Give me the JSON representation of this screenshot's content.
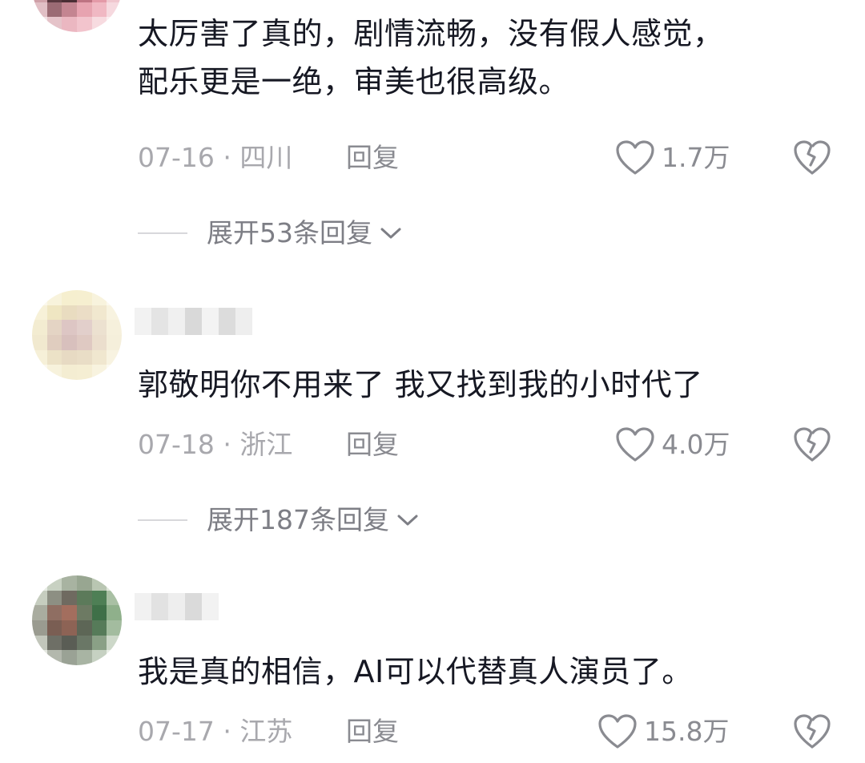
{
  "comments": [
    {
      "text_lines": [
        "太厉害了真的，剧情流畅，没有假人感觉，",
        "配乐更是一绝，审美也很高级。"
      ],
      "date_location": "07-16 · 四川",
      "reply_label": "回复",
      "likes": "1.7万",
      "expand_label": "展开53条回复"
    },
    {
      "text_lines": [
        "郭敬明你不用来了 我又找到我的小时代了"
      ],
      "date_location": "07-18 · 浙江",
      "reply_label": "回复",
      "likes": "4.0万",
      "expand_label": "展开187条回复"
    },
    {
      "text_lines": [
        "我是真的相信，AI可以代替真人演员了。"
      ],
      "date_location": "07-17 · 江苏",
      "reply_label": "回复",
      "likes": "15.8万"
    }
  ],
  "icons": {
    "like": "heart-outline-icon",
    "dislike": "broken-heart-icon",
    "expand": "chevron-down-icon"
  },
  "colors": {
    "text_primary": "#161823",
    "text_meta": "#a8a8ad",
    "text_action": "#8a8b91"
  }
}
